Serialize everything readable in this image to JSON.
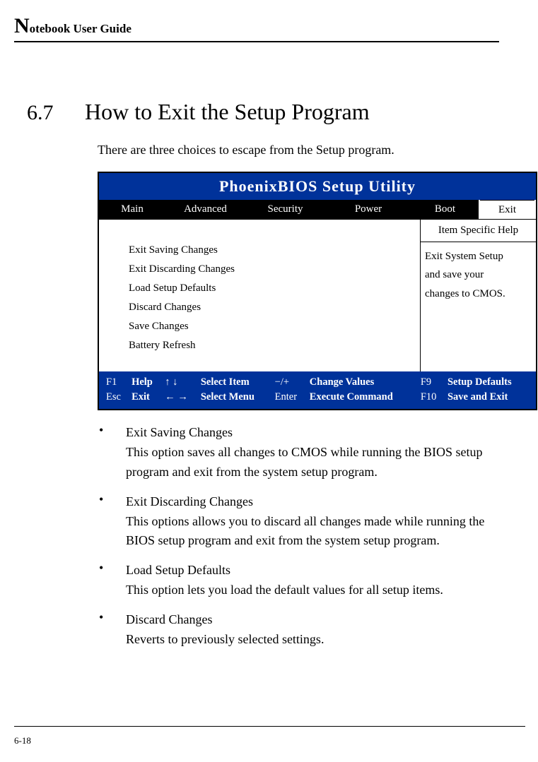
{
  "header": {
    "title_dropcap": "N",
    "title_rest": "otebook User Guide"
  },
  "section": {
    "number": "6.7",
    "title": "How to Exit the Setup Program"
  },
  "intro": "There are three choices to escape from the Setup program.",
  "bios": {
    "title": "PhoenixBIOS Setup Utility",
    "tabs": {
      "main": "Main",
      "advanced": "Advanced",
      "security": "Security",
      "power": "Power",
      "boot": "Boot",
      "exit": "Exit"
    },
    "menu": [
      "Exit Saving Changes",
      "Exit Discarding Changes",
      "Load Setup Defaults",
      "Discard Changes",
      "Save Changes",
      "Battery Refresh"
    ],
    "help_title": "Item Specific Help",
    "help_body_l1": "Exit System Setup",
    "help_body_l2": "and save your",
    "help_body_l3": "changes to CMOS.",
    "footer": {
      "r1": {
        "k1": "F1",
        "l1": "Help",
        "k2": "↑ ↓",
        "l2": "Select Item",
        "k3": "−/+",
        "l3": "Change Values",
        "k4": "F9",
        "l4": "Setup Defaults"
      },
      "r2": {
        "k1": "Esc",
        "l1": "Exit",
        "k2": "← →",
        "l2": "Select Menu",
        "k3": "Enter",
        "l3": "Execute Command",
        "k4": "F10",
        "l4": "Save and Exit"
      }
    }
  },
  "bullets": [
    {
      "title": "Exit Saving Changes",
      "body": "This option saves all changes to CMOS while running the BIOS setup program and exit from the system setup program."
    },
    {
      "title": "Exit Discarding Changes",
      "body": "This options allows you to discard all changes made while running the BIOS setup program and exit from the system setup program."
    },
    {
      "title": "Load Setup Defaults",
      "body": "This option lets you load the default values for all setup items."
    },
    {
      "title": "Discard Changes",
      "body": "Reverts to previously selected settings."
    }
  ],
  "page_number": "6-18"
}
